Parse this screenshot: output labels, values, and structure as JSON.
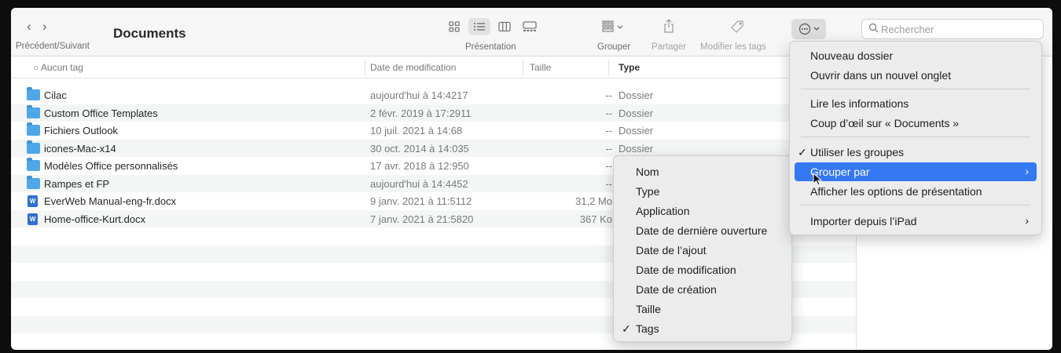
{
  "toolbar": {
    "title": "Documents",
    "nav_label": "Précédent/Suivant",
    "presentation_label": "Présentation",
    "group_label": "Grouper",
    "share_label": "Partager",
    "tags_label": "Modifier les tags",
    "search_placeholder": "Rechercher",
    "icons": [
      "back-chevron-icon",
      "forward-chevron-icon",
      "icon-view-icon",
      "list-view-icon",
      "column-view-icon",
      "gallery-view-icon",
      "group-icon",
      "share-icon",
      "tag-icon",
      "more-actions-icon",
      "search-icon"
    ]
  },
  "columns": {
    "name": "Aucun tag",
    "date": "Date de modification",
    "size": "Taille",
    "kind": "Type"
  },
  "files": [
    {
      "name": "Cilac",
      "date": "aujourd'hui à 14:4217",
      "size": "--",
      "kind": "Dossier",
      "icon": "folder"
    },
    {
      "name": "Custom Office Templates",
      "date": "2 févr. 2019 à 17:2911",
      "size": "--",
      "kind": "Dossier",
      "icon": "folder"
    },
    {
      "name": "Fichiers Outlook",
      "date": "10 juil. 2021 à 14:68",
      "size": "--",
      "kind": "Dossier",
      "icon": "folder"
    },
    {
      "name": "icones-Mac-x14",
      "date": "30 oct. 2014 à 14:035",
      "size": "--",
      "kind": "Dossier",
      "icon": "folder"
    },
    {
      "name": "Modèles Office personnalisés",
      "date": "17 avr. 2018 à 12:950",
      "size": "--",
      "kind": "",
      "icon": "folder"
    },
    {
      "name": "Rampes et FP",
      "date": "aujourd'hui à 14:4452",
      "size": "--",
      "kind": "",
      "icon": "folder"
    },
    {
      "name": "EverWeb Manual-eng-fr.docx",
      "date": "9 janv. 2021 à 11:5112",
      "size": "31,2 Mo",
      "kind": "",
      "icon": "docx"
    },
    {
      "name": "Home-office-Kurt.docx",
      "date": "7 janv. 2021 à 21:5820",
      "size": "367 Ko",
      "kind": "",
      "icon": "docx"
    }
  ],
  "context_menu": {
    "items": [
      {
        "label": "Nouveau dossier"
      },
      {
        "label": "Ouvrir dans un nouvel onglet"
      },
      {
        "label": "Lire les informations"
      },
      {
        "label": "Coup d’œil sur « Documents »"
      },
      {
        "label": "Utiliser les groupes",
        "checked": true
      },
      {
        "label": "Grouper par",
        "submenu": true,
        "highlighted": true
      },
      {
        "label": "Afficher les options de présentation"
      },
      {
        "label": "Importer depuis l’iPad",
        "submenu": true
      }
    ]
  },
  "submenu": {
    "items": [
      {
        "label": "Nom"
      },
      {
        "label": "Type"
      },
      {
        "label": "Application"
      },
      {
        "label": "Date de dernière ouverture"
      },
      {
        "label": "Date de l’ajout"
      },
      {
        "label": "Date de modification"
      },
      {
        "label": "Date de création"
      },
      {
        "label": "Taille"
      },
      {
        "label": "Tags",
        "checked": true
      }
    ]
  },
  "colors": {
    "accent": "#3478f6",
    "folder": "#4ea7e8",
    "docx": "#2f6fd1"
  }
}
